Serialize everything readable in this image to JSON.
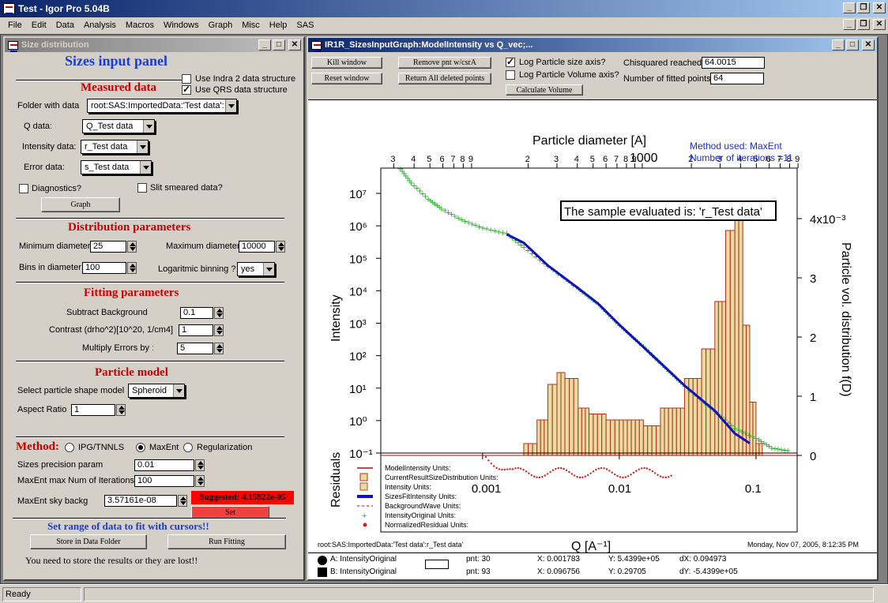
{
  "app": {
    "title": "Test - Igor Pro 5.04B"
  },
  "menu": [
    "File",
    "Edit",
    "Data",
    "Analysis",
    "Macros",
    "Windows",
    "Graph",
    "Misc",
    "Help",
    "SAS"
  ],
  "panel": {
    "title": "Size distribution",
    "heading": "Sizes input panel",
    "measured_header": "Measured data",
    "use_indra": "Use Indra 2 data structure",
    "use_qrs": "Use QRS data structure",
    "folder_label": "Folder with data",
    "folder_value": "root:SAS:ImportedData:'Test data':",
    "q_label": "Q data:",
    "q_value": "Q_Test data",
    "intensity_label": "Intensity data:",
    "intensity_value": "r_Test data",
    "error_label": "Error data:",
    "error_value": "s_Test data",
    "diagnostics": "Diagnostics?",
    "slit": "Slit smeared data?",
    "graph_button": "Graph",
    "dist_header": "Distribution parameters",
    "min_diam_label": "Minimum diameter",
    "min_diam": "25",
    "max_diam_label": "Maximum diameter",
    "max_diam": "10000",
    "bins_label": "Bins in diameter",
    "bins": "100",
    "log_bin_label": "Logaritmic binning ?",
    "log_bin": "yes",
    "fit_header": "Fitting parameters",
    "bkg_label": "Subtract Background",
    "bkg": "0.1",
    "contrast_label": "Contrast (drho^2)[10^20, 1/cm4]",
    "contrast": "1",
    "mult_label": "Multiply Errors by :",
    "mult": "5",
    "model_header": "Particle model",
    "shape_label": "Select particle shape model",
    "shape": "Spheroid",
    "aspect_label": "Aspect Ratio",
    "aspect": "1",
    "method_label": "Method:",
    "method_ipg": "IPG/TNNLS",
    "method_maxent": "MaxEnt",
    "method_reg": "Regularization",
    "precision_label": "Sizes precision param",
    "precision": "0.01",
    "maxiter_label": "MaxEnt max Num of Iterations",
    "maxiter": "100",
    "sky_label": "MaxEnt sky backg",
    "sky": "3.57161e-08",
    "suggested": "Suggested:  4.15922e-05",
    "set_button": "Set",
    "range_header": "Set range of data to fit with cursors!!",
    "store_button": "Store in Data Folder",
    "run_button": "Run Fitting",
    "warning": "You need to store the results or they are lost!!"
  },
  "graphwin": {
    "title": "IR1R_SizesInputGraph:ModelIntensity vs Q_vec;...",
    "kill": "Kill window",
    "reset": "Reset window",
    "remove": "Remove pnt w/csrA",
    "return": "Return All deleted points",
    "log_size": "Log Particle size axis?",
    "log_vol": "Log Particle Volume axis?",
    "calc_vol": "Calculate Volume",
    "chisq_label": "Chisquared reached",
    "chisq": "64.0015",
    "npts_label": "Number of fitted points",
    "npts": "64",
    "footer_left": "root:SAS:ImportedData:'Test data':r_Test data'",
    "footer_right": "Monday, Nov 07, 2005, 8:12:35 PM",
    "cursor_a": "A: IntensityOriginal",
    "cursor_b": "B: IntensityOriginal",
    "pnt_a": "pnt: 30",
    "pnt_b": "pnt: 93",
    "xa": "X: 0.001783",
    "xb": "X: 0.096756",
    "ya": "Y: 5.4399e+05",
    "yb": "Y: 0.29705",
    "dx": "dX: 0.094973",
    "dy": "dY: -5.4399e+05"
  },
  "chart_data": {
    "type": "scatter",
    "top_axis_label": "Particle diameter [A]",
    "xlabel": "Q [A⁻¹]",
    "ylabel": "Intensity",
    "right_label": "Particle vol. distribution f(D)",
    "residuals_label": "Residuals",
    "annotation": "The sample evaluated is:  'r_Test data'",
    "method_text": "Method used: MaxEnt",
    "iterations_text": "Number of iterations =11",
    "x_scale": "log",
    "y_scale": "log",
    "xlim": [
      0.00018,
      0.2
    ],
    "ylim": [
      0.1,
      60000000.0
    ],
    "x_ticks": [
      "0.001",
      "0.01",
      "0.1"
    ],
    "y_ticks": [
      "10⁻¹",
      "10⁰",
      "10¹",
      "10²",
      "10³",
      "10⁴",
      "10⁵",
      "10⁶",
      "10⁷"
    ],
    "right_ticks": [
      "0",
      "1",
      "2",
      "3",
      "4x10⁻³"
    ],
    "top_ticks": [
      "3",
      "4",
      "5",
      "6",
      "7",
      "8",
      "9",
      "2",
      "3",
      "4",
      "5",
      "6",
      "7",
      "8",
      "9",
      "1000",
      "2",
      "3",
      "4",
      "5",
      "6",
      "7",
      "8",
      "9"
    ],
    "legend": [
      {
        "name": "ModelIntensity",
        "units": "Units:"
      },
      {
        "name": "CurrentResultSizeDistribution",
        "units": "Units:"
      },
      {
        "name": "Intensity",
        "units": "Units:"
      },
      {
        "name": "SizesFitIntensity",
        "units": "Units:"
      },
      {
        "name": "BackgroundWave",
        "units": "Units:"
      },
      {
        "name": "IntensityOriginal",
        "units": "Units:"
      },
      {
        "name": "NormalizedResidual",
        "units": "Units:"
      }
    ],
    "series": [
      {
        "name": "IntensityOriginal",
        "x": [
          0.00025,
          0.0003,
          0.0004,
          0.0005,
          0.0007,
          0.001,
          0.0015,
          0.002,
          0.003,
          0.005,
          0.007,
          0.01,
          0.015,
          0.02,
          0.03,
          0.05,
          0.07,
          0.1,
          0.13,
          0.18
        ],
        "y": [
          60000000,
          22000000,
          7000000,
          3500000,
          1600000,
          900000,
          600000,
          230000,
          60000,
          12000,
          4000,
          900,
          200,
          60,
          12,
          2,
          0.6,
          0.3,
          0.15,
          0.12
        ]
      },
      {
        "name": "SizesFitIntensity",
        "x": [
          0.0015,
          0.002,
          0.003,
          0.005,
          0.007,
          0.01,
          0.02,
          0.03,
          0.05,
          0.07,
          0.09
        ],
        "y": [
          550000,
          300000,
          60000,
          12000,
          4000,
          900,
          60,
          12,
          2,
          0.4,
          0.2
        ]
      }
    ],
    "size_distribution": {
      "x": [
        0.002,
        0.0025,
        0.003,
        0.0035,
        0.004,
        0.005,
        0.006,
        0.008,
        0.01,
        0.015,
        0.02,
        0.03,
        0.04,
        0.05,
        0.06,
        0.07,
        0.08,
        0.09,
        0.1
      ],
      "values": [
        0.0002,
        0.0006,
        0.0012,
        0.0014,
        0.0013,
        0.0008,
        0.0007,
        0.0006,
        0.0006,
        0.0005,
        0.0008,
        0.0013,
        0.0018,
        0.0026,
        0.0038,
        0.0042,
        0.0022,
        0.0009,
        0.0002
      ]
    }
  },
  "status": {
    "ready": "Ready"
  }
}
